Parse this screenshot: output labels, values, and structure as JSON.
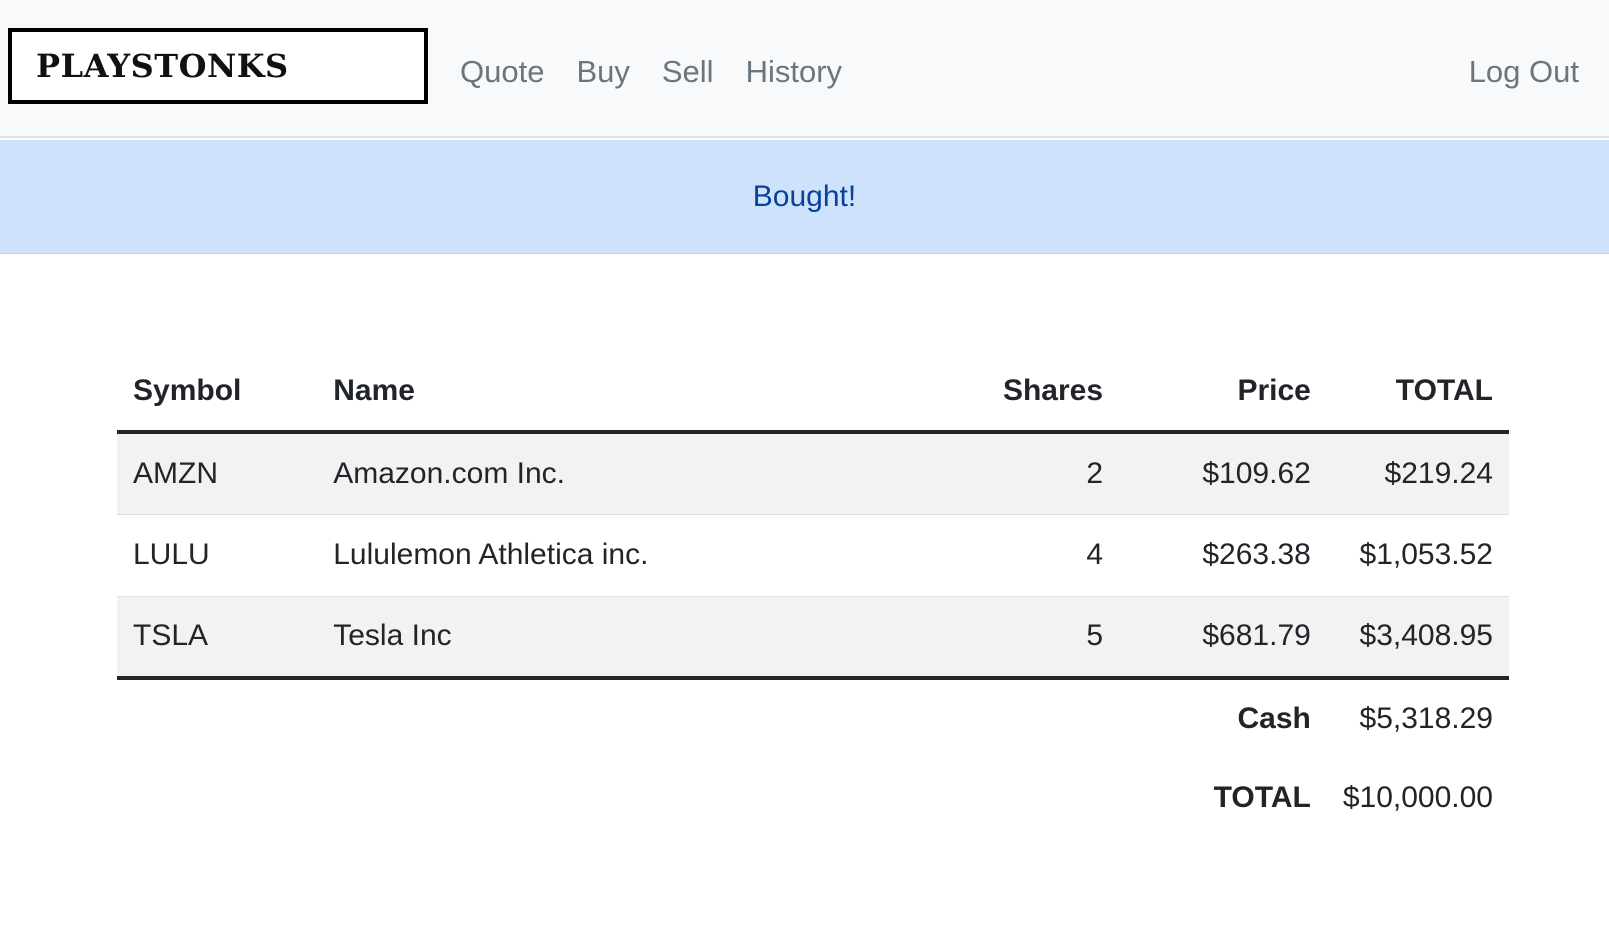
{
  "nav": {
    "brand": "PLAYSTONKS",
    "links": [
      "Quote",
      "Buy",
      "Sell",
      "History"
    ],
    "logout": "Log Out"
  },
  "alert": {
    "message": "Bought!",
    "color": "#cfe2fc"
  },
  "portfolio": {
    "headers": {
      "symbol": "Symbol",
      "name": "Name",
      "shares": "Shares",
      "price": "Price",
      "total": "TOTAL"
    },
    "rows": [
      {
        "symbol": "AMZN",
        "name": "Amazon.com Inc.",
        "shares": "2",
        "price": "$109.62",
        "total": "$219.24"
      },
      {
        "symbol": "LULU",
        "name": "Lululemon Athletica inc.",
        "shares": "4",
        "price": "$263.38",
        "total": "$1,053.52"
      },
      {
        "symbol": "TSLA",
        "name": "Tesla Inc",
        "shares": "5",
        "price": "$681.79",
        "total": "$3,408.95"
      }
    ],
    "cash_label": "Cash",
    "cash_value": "$5,318.29",
    "grand_total_label": "TOTAL",
    "grand_total_value": "$10,000.00"
  }
}
